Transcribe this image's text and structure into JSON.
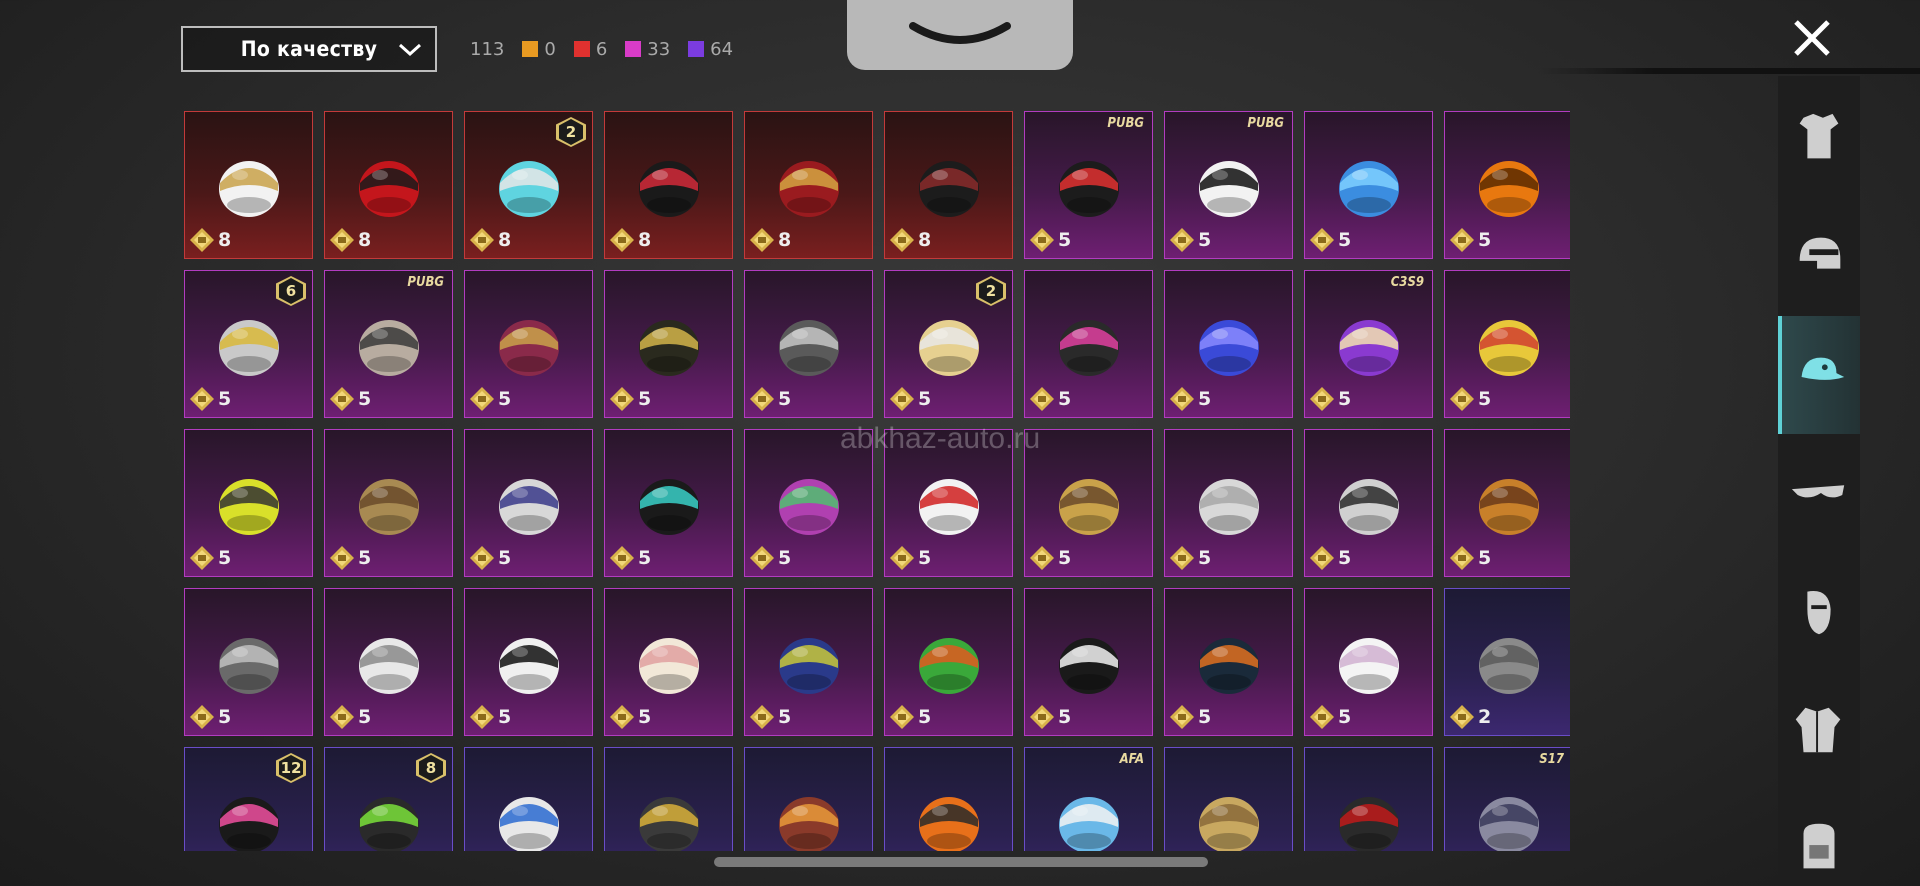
{
  "toolbar": {
    "sort_label": "По качеству",
    "total": "113",
    "counts": [
      {
        "color": "#e89a22",
        "value": "0"
      },
      {
        "color": "#e0312f",
        "value": "6"
      },
      {
        "color": "#d93cc8",
        "value": "33"
      },
      {
        "color": "#7b3ce0",
        "value": "64"
      }
    ]
  },
  "watermark": "abkhaz-auto.ru",
  "items": [
    {
      "rarity": "red",
      "price": "8",
      "icon": "cowboy-hat-icon",
      "art": "#f2f2f2",
      "art2": "#c9a24a"
    },
    {
      "rarity": "red",
      "price": "8",
      "icon": "red-helmet-icon",
      "art": "#c4161c",
      "art2": "#1a1a1a"
    },
    {
      "rarity": "red",
      "price": "8",
      "icon": "bucket-hat-icon",
      "art": "#5fd4e0",
      "art2": "#e6e6e6",
      "badge": "2"
    },
    {
      "rarity": "red",
      "price": "8",
      "icon": "demon-mask-icon",
      "art": "#1a1a1a",
      "art2": "#d42a3a"
    },
    {
      "rarity": "red",
      "price": "8",
      "icon": "crimson-helmet-icon",
      "art": "#9a1b1f",
      "art2": "#d4a542"
    },
    {
      "rarity": "red",
      "price": "8",
      "icon": "black-rabbit-helmet-icon",
      "art": "#1c1c1c",
      "art2": "#8a2a2a"
    },
    {
      "rarity": "pink",
      "price": "5",
      "icon": "cap-visor-icon",
      "art": "#1c1c1c",
      "art2": "#e03030",
      "season": "PUBG"
    },
    {
      "rarity": "pink",
      "price": "5",
      "icon": "panda-mask-icon",
      "art": "#f2f2f2",
      "art2": "#111111",
      "season": "PUBG"
    },
    {
      "rarity": "pink",
      "price": "5",
      "icon": "blue-bird-icon",
      "art": "#3b8de0",
      "art2": "#7fd0ff"
    },
    {
      "rarity": "pink",
      "price": "5",
      "icon": "pumpkin-icon",
      "art": "#e8780f",
      "art2": "#5a2a00"
    },
    {
      "rarity": "pink",
      "price": "5",
      "icon": "gold-mask-icon",
      "art": "#c9c9c9",
      "art2": "#d9b83a",
      "badge": "6"
    },
    {
      "rarity": "pink",
      "price": "5",
      "icon": "sack-mask-icon",
      "art": "#b8aca0",
      "art2": "#3a3a3a",
      "season": "PUBG"
    },
    {
      "rarity": "pink",
      "price": "5",
      "icon": "witch-hat-icon",
      "art": "#8a2a4a",
      "art2": "#c9a24a"
    },
    {
      "rarity": "pink",
      "price": "5",
      "icon": "wide-hat-icon",
      "art": "#2a2a1e",
      "art2": "#d2b44a"
    },
    {
      "rarity": "pink",
      "price": "5",
      "icon": "spiked-helmet-icon",
      "art": "#5a5a5a",
      "art2": "#c6c6c6"
    },
    {
      "rarity": "pink",
      "price": "5",
      "icon": "blonde-hat-icon",
      "art": "#e6d090",
      "art2": "#e8e8e8",
      "badge": "2"
    },
    {
      "rarity": "pink",
      "price": "5",
      "icon": "neon-hood-icon",
      "art": "#2a2a2a",
      "art2": "#e040a0"
    },
    {
      "rarity": "pink",
      "price": "5",
      "icon": "blue-oni-mask-icon",
      "art": "#3a4ad8",
      "art2": "#8a8aff"
    },
    {
      "rarity": "pink",
      "price": "5",
      "icon": "purple-cap-icon",
      "art": "#8a3ad0",
      "art2": "#f2e2b0",
      "season": "C3S9"
    },
    {
      "rarity": "pink",
      "price": "5",
      "icon": "duck-headset-icon",
      "art": "#e8c83a",
      "art2": "#d04030"
    },
    {
      "rarity": "pink",
      "price": "5",
      "icon": "yellow-bucket-hat-icon",
      "art": "#d9e02a",
      "art2": "#333333"
    },
    {
      "rarity": "pink",
      "price": "5",
      "icon": "straw-hat-icon",
      "art": "#a88a52",
      "art2": "#6a4a2a"
    },
    {
      "rarity": "pink",
      "price": "5",
      "icon": "cone-hat-icon",
      "art": "#d8d8d8",
      "art2": "#3a3a8a"
    },
    {
      "rarity": "pink",
      "price": "5",
      "icon": "ninja-mask-icon",
      "art": "#1a1a1a",
      "art2": "#3ad0c8"
    },
    {
      "rarity": "pink",
      "price": "5",
      "icon": "jester-hat-icon",
      "art": "#b040b0",
      "art2": "#50c070"
    },
    {
      "rarity": "pink",
      "price": "5",
      "icon": "chicken-mask-icon",
      "art": "#f2f2f2",
      "art2": "#d02020"
    },
    {
      "rarity": "pink",
      "price": "5",
      "icon": "cake-hat-icon",
      "art": "#c9a24a",
      "art2": "#6a4a2a"
    },
    {
      "rarity": "pink",
      "price": "5",
      "icon": "silver-hair-icon",
      "art": "#d8d8d8",
      "art2": "#a8a8a8"
    },
    {
      "rarity": "pink",
      "price": "5",
      "icon": "dreadlocks-icon",
      "art": "#d0d0d0",
      "art2": "#2a2a2a"
    },
    {
      "rarity": "pink",
      "price": "5",
      "icon": "camel-mask-icon",
      "art": "#c8802a",
      "art2": "#6a3a1a"
    },
    {
      "rarity": "pink",
      "price": "5",
      "icon": "wolf-mask-icon",
      "art": "#6a6a6a",
      "art2": "#c0c0c0"
    },
    {
      "rarity": "pink",
      "price": "5",
      "icon": "rabbit-mask-icon",
      "art": "#e8e8e8",
      "art2": "#8a8a8a"
    },
    {
      "rarity": "pink",
      "price": "5",
      "icon": "zebra-mask-icon",
      "art": "#f0f0f0",
      "art2": "#111111"
    },
    {
      "rarity": "pink",
      "price": "5",
      "icon": "sheep-mask-icon",
      "art": "#f2e8d8",
      "art2": "#e0a0a0"
    },
    {
      "rarity": "pink",
      "price": "5",
      "icon": "goggles-beanie-icon",
      "art": "#2a3a8a",
      "art2": "#c8c83a"
    },
    {
      "rarity": "pink",
      "price": "5",
      "icon": "frog-cap-icon",
      "art": "#3aa83a",
      "art2": "#e05a20"
    },
    {
      "rarity": "pink",
      "price": "5",
      "icon": "top-hat-icon",
      "art": "#1a1a1a",
      "art2": "#f2f2f2"
    },
    {
      "rarity": "pink",
      "price": "5",
      "icon": "space-helmet-icon",
      "art": "#1a2a3a",
      "art2": "#e07020"
    },
    {
      "rarity": "pink",
      "price": "5",
      "icon": "white-sun-hat-icon",
      "art": "#f4f4f4",
      "art2": "#d0b0d0"
    },
    {
      "rarity": "purple",
      "price": "2",
      "icon": "gray-hair-icon",
      "art": "#8a8a8a",
      "art2": "#5a5a5a"
    },
    {
      "rarity": "purple",
      "price": "",
      "icon": "bunny-ears-icon",
      "art": "#1a1a1a",
      "art2": "#f050a0",
      "badge": "12"
    },
    {
      "rarity": "purple",
      "price": "",
      "icon": "green-skull-hood-icon",
      "art": "#2a2a2a",
      "art2": "#7ae03a",
      "badge": "8"
    },
    {
      "rarity": "purple",
      "price": "",
      "icon": "baseball-cap-icon",
      "art": "#e8e8e8",
      "art2": "#2a6ad0"
    },
    {
      "rarity": "purple",
      "price": "",
      "icon": "motorcycle-helmet-icon",
      "art": "#3a3a3a",
      "art2": "#d8b03a"
    },
    {
      "rarity": "purple",
      "price": "",
      "icon": "aviator-goggles-icon",
      "art": "#8a3a2a",
      "art2": "#e89a3a"
    },
    {
      "rarity": "purple",
      "price": "",
      "icon": "orange-spike-helmet-icon",
      "art": "#e8701a",
      "art2": "#2a2a2a"
    },
    {
      "rarity": "purple",
      "price": "",
      "icon": "blue-cap-icon",
      "art": "#6ab8e8",
      "art2": "#f2f2f2",
      "season": "AFA"
    },
    {
      "rarity": "purple",
      "price": "",
      "icon": "golden-hair-icon",
      "art": "#c8a860",
      "art2": "#8a6a3a"
    },
    {
      "rarity": "purple",
      "price": "",
      "icon": "black-bucket-hat-icon",
      "art": "#2a2a2a",
      "art2": "#c01a1a"
    },
    {
      "rarity": "purple",
      "price": "",
      "icon": "horned-helmet-icon",
      "art": "#8a8aa0",
      "art2": "#3a3a5a",
      "season": "S17"
    }
  ],
  "side_categories": [
    {
      "name": "outfit-category-icon",
      "active": false
    },
    {
      "name": "helmet-category-icon",
      "active": false
    },
    {
      "name": "hat-category-icon",
      "active": true
    },
    {
      "name": "glasses-category-icon",
      "active": false
    },
    {
      "name": "face-mask-category-icon",
      "active": false
    },
    {
      "name": "jacket-category-icon",
      "active": false
    },
    {
      "name": "backpack-category-icon",
      "active": false
    }
  ]
}
